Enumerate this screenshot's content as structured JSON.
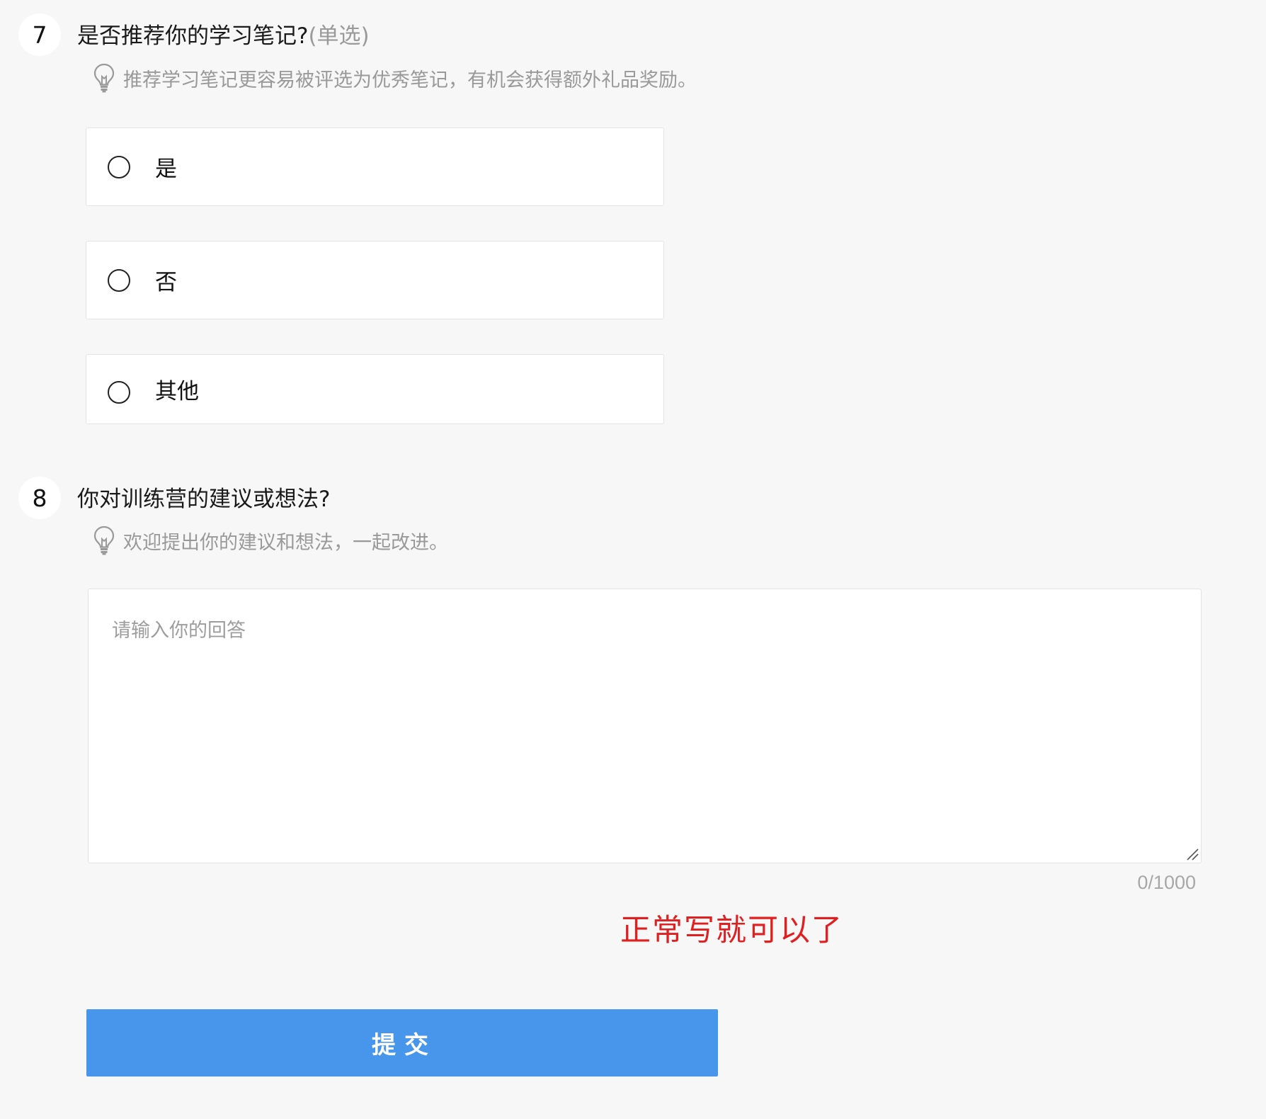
{
  "questions": [
    {
      "number": "7",
      "title": "是否推荐你的学习笔记?",
      "type": "(单选)",
      "hint": "推荐学习笔记更容易被评选为优秀笔记，有机会获得额外礼品奖励。",
      "options": [
        {
          "label": "是",
          "selected": false
        },
        {
          "label": "否",
          "selected": false
        },
        {
          "label": "其他",
          "selected": false
        }
      ]
    },
    {
      "number": "8",
      "title": "你对训练营的建议或想法?",
      "hint": "欢迎提出你的建议和想法，一起改进。",
      "answer": {
        "placeholder": "请输入你的回答",
        "value": "",
        "counter": "0/1000"
      }
    }
  ],
  "annotation": "正常写就可以了",
  "submit": {
    "label": "提交",
    "color": "#4896ec"
  },
  "colors": {
    "page_background": "#f7f7f7",
    "annotation": "#e02020",
    "hint_text": "#999999"
  },
  "icons": {
    "hint": "lightbulb-icon",
    "option": "radio-icon",
    "resize": "resize-handle-icon"
  }
}
